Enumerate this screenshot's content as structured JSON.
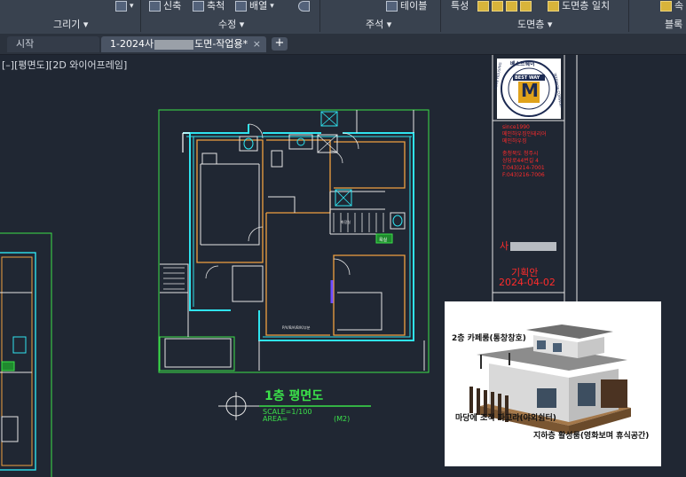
{
  "ribbon": {
    "tools": {
      "shrink": "신축",
      "scale": "축척",
      "array": "배열",
      "table": "테이블",
      "properties": "특성",
      "match_layer": "도면층 일치",
      "right_cut": "속"
    },
    "groups": {
      "draw": "그리기",
      "modify": "수정",
      "annotation": "주석",
      "layers": "도면층",
      "block": "블록"
    }
  },
  "tabs": {
    "start": "시작",
    "file_prefix": "1-2024사",
    "file_suffix": "도면-작업용*",
    "close": "×",
    "add": "+"
  },
  "viewport": {
    "label": "[–][평면도][2D 와이어프레임]"
  },
  "title_block": {
    "logo_top": "베스트웨이",
    "logo_banner": "BEST WAY",
    "logo_letter": "M",
    "logo_left": "MAIN HOUSING",
    "logo_right": "INTERIOR COMPANY",
    "info_lines": [
      "since1990",
      "메인하우징인테리어",
      "메인하우징",
      "충청북도 청주시",
      "상당로44번길 4",
      "T:043)214-7001",
      "F:043)216-7006"
    ],
    "project_prefix": "사",
    "planner": "기획안",
    "date": "2024-04-02"
  },
  "plan": {
    "title": "1층 평면도",
    "scale": "SCALE=1/100",
    "area": "AREA=",
    "area_unit": "(M2)",
    "room_label": "화장실",
    "room_label_left": "욕실",
    "wall_note": "P/V/B/A/B/K/부분"
  },
  "photo": {
    "caption_top": "2층 카페룸(통창창호)",
    "caption_mid": "마당에 조적 파고라(야외쉼터)",
    "caption_bottom": "지하층 활성룸(영화보며 휴식공간)"
  },
  "colors": {
    "ribbon_bg": "#39424f",
    "canvas_bg": "#202733",
    "green": "#3be14a",
    "red": "#ff2b2b",
    "cyan": "#2fe3ef",
    "orange": "#f0a040"
  }
}
